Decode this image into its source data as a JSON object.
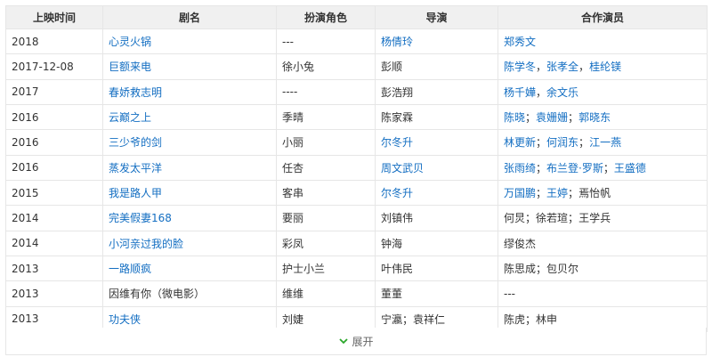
{
  "table": {
    "headers": [
      "上映时间",
      "剧名",
      "扮演角色",
      "导演",
      "合作演员"
    ],
    "rows": [
      {
        "date": "2018",
        "title": "心灵火锅",
        "title_link": true,
        "role": "---",
        "director": "杨倩玲",
        "director_link": true,
        "cast": [
          {
            "name": "郑秀文",
            "link": true
          }
        ]
      },
      {
        "date": "2017-12-08",
        "title": "巨额来电",
        "title_link": true,
        "role": "徐小兔",
        "director": "彭顺",
        "director_link": false,
        "cast": [
          {
            "name": "陈学冬",
            "link": true
          },
          {
            "name": "张孝全",
            "link": true
          },
          {
            "name": "桂纶镁",
            "link": true
          }
        ],
        "cast_sep": "，"
      },
      {
        "date": "2017",
        "title": "春娇救志明",
        "title_link": true,
        "role": "----",
        "director": "彭浩翔",
        "director_link": false,
        "cast": [
          {
            "name": "杨千嬅",
            "link": true
          },
          {
            "name": "余文乐",
            "link": true
          }
        ],
        "cast_sep": "，"
      },
      {
        "date": "2016",
        "title": "云巅之上",
        "title_link": true,
        "role": "季晴",
        "director": "陈家霖",
        "director_link": false,
        "cast": [
          {
            "name": "陈晓",
            "link": true
          },
          {
            "name": "袁姗姗",
            "link": true
          },
          {
            "name": "郭晓东",
            "link": true
          }
        ],
        "cast_sep": "；"
      },
      {
        "date": "2016",
        "title": "三少爷的剑",
        "title_link": true,
        "role": "小丽",
        "director": "尔冬升",
        "director_link": true,
        "cast": [
          {
            "name": "林更新",
            "link": true
          },
          {
            "name": "何润东",
            "link": true
          },
          {
            "name": "江一燕",
            "link": true
          }
        ],
        "cast_sep": "；"
      },
      {
        "date": "2016",
        "title": "蒸发太平洋",
        "title_link": true,
        "role": "任杏",
        "director": "周文武贝",
        "director_link": true,
        "cast": [
          {
            "name": "张雨绮",
            "link": true
          },
          {
            "name": "布兰登·罗斯",
            "link": true
          },
          {
            "name": "王盛德",
            "link": true
          }
        ],
        "cast_sep": "；"
      },
      {
        "date": "2015",
        "title": "我是路人甲",
        "title_link": true,
        "role": "客串",
        "director": "尔冬升",
        "director_link": true,
        "cast": [
          {
            "name": "万国鹏",
            "link": true
          },
          {
            "name": "王婷",
            "link": true
          },
          {
            "name": "焉怡帆",
            "link": false
          }
        ],
        "cast_sep": "；"
      },
      {
        "date": "2014",
        "title": "完美假妻168",
        "title_link": true,
        "role": "要丽",
        "director": "刘镇伟",
        "director_link": false,
        "cast": [
          {
            "name": "何炅",
            "link": false
          },
          {
            "name": "徐若瑄",
            "link": false
          },
          {
            "name": "王学兵",
            "link": false
          }
        ],
        "cast_sep": "；"
      },
      {
        "date": "2014",
        "title": "小河亲过我的脸",
        "title_link": true,
        "role": "彩凤",
        "director": "钟海",
        "director_link": false,
        "cast": [
          {
            "name": "缪俊杰",
            "link": false
          }
        ]
      },
      {
        "date": "2013",
        "title": "一路顺疯",
        "title_link": true,
        "role": "护士小兰",
        "director": "叶伟民",
        "director_link": false,
        "cast": [
          {
            "name": "陈思成",
            "link": false
          },
          {
            "name": "包贝尔",
            "link": false
          }
        ],
        "cast_sep": "；"
      },
      {
        "date": "2013",
        "title": "因维有你（微电影）",
        "title_link": false,
        "role": "维维",
        "director": "董董",
        "director_link": false,
        "cast": [
          {
            "name": "---",
            "link": false
          }
        ]
      },
      {
        "date": "2013",
        "title": "功夫侠",
        "title_link": true,
        "role": "刘婕",
        "director": "宁瀛；袁祥仁",
        "director_link": false,
        "cast": [
          {
            "name": "陈虎",
            "link": false
          },
          {
            "name": "林申",
            "link": false
          }
        ],
        "cast_sep": "；"
      }
    ]
  },
  "footer": {
    "expand_label": "展开",
    "icon": "chevron-down-icon",
    "icon_color": "#2aa72a"
  },
  "colors": {
    "link": "#136ec2",
    "header_bg": "#f0f0f0",
    "border": "#e6e6e6"
  }
}
